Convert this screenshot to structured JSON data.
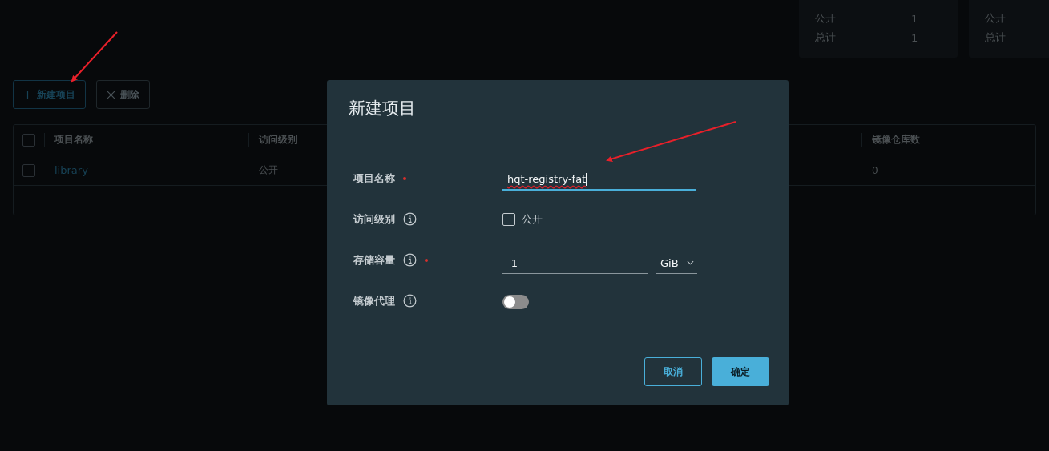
{
  "stats_cards": [
    {
      "rows": [
        {
          "label": "公开",
          "value": "1"
        },
        {
          "label": "总计",
          "value": "1"
        }
      ]
    },
    {
      "rows": [
        {
          "label": "公开"
        },
        {
          "label": "总计"
        }
      ]
    }
  ],
  "toolbar": {
    "buttons": [
      {
        "label": "新建项目",
        "kind": "add",
        "disabled": false
      },
      {
        "label": "删除",
        "kind": "delete",
        "disabled": true
      }
    ]
  },
  "table": {
    "header_checked": false,
    "columns": [
      "项目名称",
      "访问级别",
      "镜像仓库数"
    ],
    "rows": [
      {
        "selected": false,
        "cells": [
          "library",
          "公开",
          "0"
        ]
      }
    ]
  },
  "dialog": {
    "title": "新建项目",
    "fields": [
      {
        "kind": "text",
        "label": "项目名称",
        "required": true,
        "info": false,
        "value": "hqt-registry-fat",
        "focused": true
      },
      {
        "kind": "checkbox",
        "label": "访问级别",
        "required": false,
        "info": true,
        "option": "公开",
        "checked": false
      },
      {
        "kind": "quota",
        "label": "存储容量",
        "required": true,
        "info": true,
        "value": "-1",
        "unit": "GiB"
      },
      {
        "kind": "toggle",
        "label": "镜像代理",
        "required": false,
        "info": true,
        "on": false
      }
    ],
    "buttons": [
      {
        "label": "取消",
        "kind": "secondary"
      },
      {
        "label": "确定",
        "kind": "primary"
      }
    ]
  }
}
